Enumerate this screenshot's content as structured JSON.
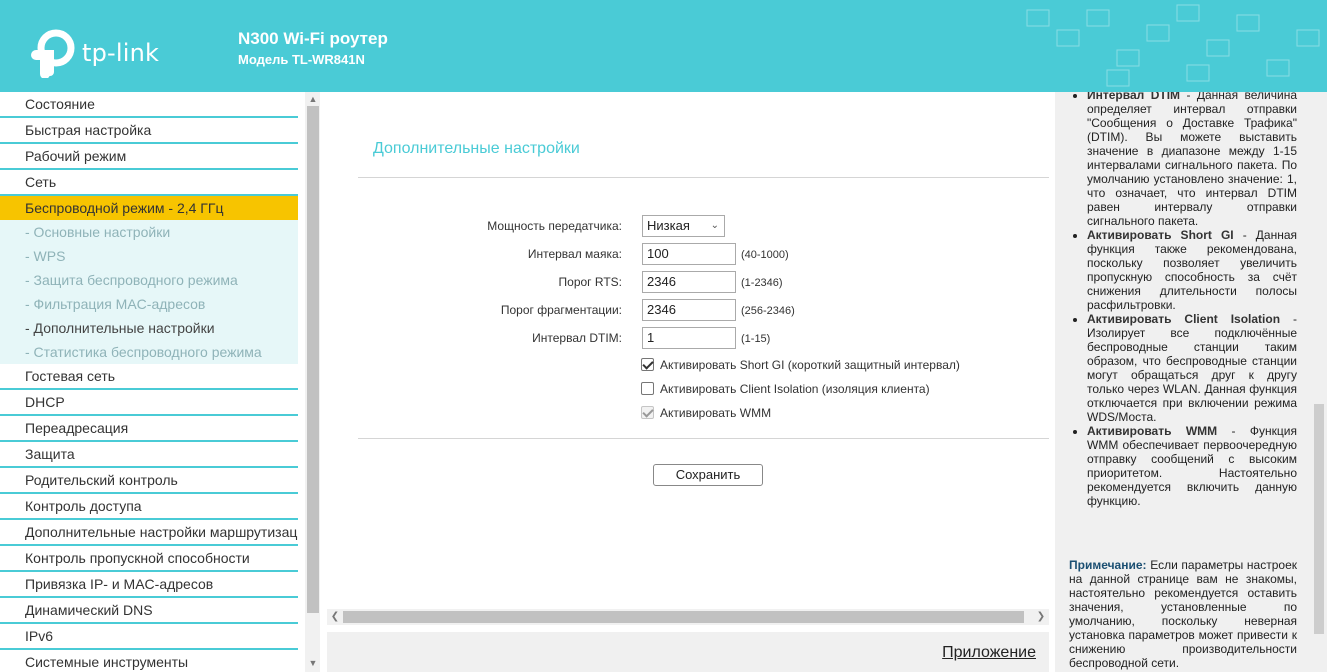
{
  "header": {
    "logo_text": "tp-link",
    "title": "N300 Wi-Fi роутер",
    "model": "Модель TL-WR841N"
  },
  "sidebar": {
    "items_top": [
      {
        "label": "Состояние"
      },
      {
        "label": "Быстрая настройка"
      },
      {
        "label": "Рабочий режим"
      },
      {
        "label": "Сеть"
      }
    ],
    "active": {
      "label": "Беспроводной режим - 2,4 ГГц"
    },
    "subitems": [
      {
        "label": "- Основные настройки"
      },
      {
        "label": "- WPS"
      },
      {
        "label": "- Защита беспроводного режима"
      },
      {
        "label": "- Фильтрация MAC-адресов"
      },
      {
        "label": "- Дополнительные настройки"
      },
      {
        "label": "- Статистика беспроводного режима"
      }
    ],
    "items_bottom": [
      {
        "label": "Гостевая сеть"
      },
      {
        "label": "DHCP"
      },
      {
        "label": "Переадресация"
      },
      {
        "label": "Защита"
      },
      {
        "label": "Родительский контроль"
      },
      {
        "label": "Контроль доступа"
      },
      {
        "label": "Дополнительные настройки маршрутизации"
      },
      {
        "label": "Контроль пропускной способности"
      },
      {
        "label": "Привязка IP- и MAC-адресов"
      },
      {
        "label": "Динамический DNS"
      },
      {
        "label": "IPv6"
      },
      {
        "label": "Системные инструменты"
      }
    ]
  },
  "main": {
    "section_title": "Дополнительные настройки",
    "tx_power": {
      "label": "Мощность передатчика:",
      "value": "Низкая"
    },
    "beacon": {
      "label": "Интервал маяка:",
      "value": "100",
      "range": "(40-1000)"
    },
    "rts": {
      "label": "Порог RTS:",
      "value": "2346",
      "range": "(1-2346)"
    },
    "frag": {
      "label": "Порог фрагментации:",
      "value": "2346",
      "range": "(256-2346)"
    },
    "dtim": {
      "label": "Интервал DTIM:",
      "value": "1",
      "range": "(1-15)"
    },
    "short_gi": {
      "label": "Активировать Short GI (короткий защитный интервал)",
      "checked": true
    },
    "client_iso": {
      "label": "Активировать Client Isolation (изоляция клиента)",
      "checked": false
    },
    "wmm": {
      "label": "Активировать WMM",
      "checked": true,
      "disabled": true
    },
    "save_label": "Сохранить",
    "app_link": "Приложение"
  },
  "help": {
    "dtim_head": "Интервал DTIM",
    "dtim_text": " - Данная величина определяет интервал отправки \"Сообщения о Доставке Трафика\" (DTIM). Вы можете выставить значение в диапазоне между 1-15 интервалами сигнального пакета. По умолчанию установлено значение: 1, что означает, что интервал DTIM равен интервалу отправки сигнального пакета.",
    "sgi_head": "Активировать Short GI",
    "sgi_text": " - Данная функция также рекомендована, поскольку позволяет увеличить пропускную способность за счёт снижения длительности полосы расфильтровки.",
    "iso_head": "Активировать Client Isolation",
    "iso_text": " - Изолирует все подключённые беспроводные станции таким образом, что беспроводные станции могут обращаться друг к другу только через WLAN. Данная функция отключается при включении режима WDS/Моста.",
    "wmm_head": "Активировать WMM",
    "wmm_text": " - Функция WMM обеспечивает первоочередную отправку сообщений с высоким приоритетом. Настоятельно рекомендуется включить данную функцию.",
    "note_head": "Примечание:",
    "note_text": " Если параметры настроек на данной странице вам не знакомы, настоятельно рекомендуется оставить значения, установленные по умолчанию, поскольку неверная установка параметров может привести к снижению производительности беспроводной сети."
  }
}
